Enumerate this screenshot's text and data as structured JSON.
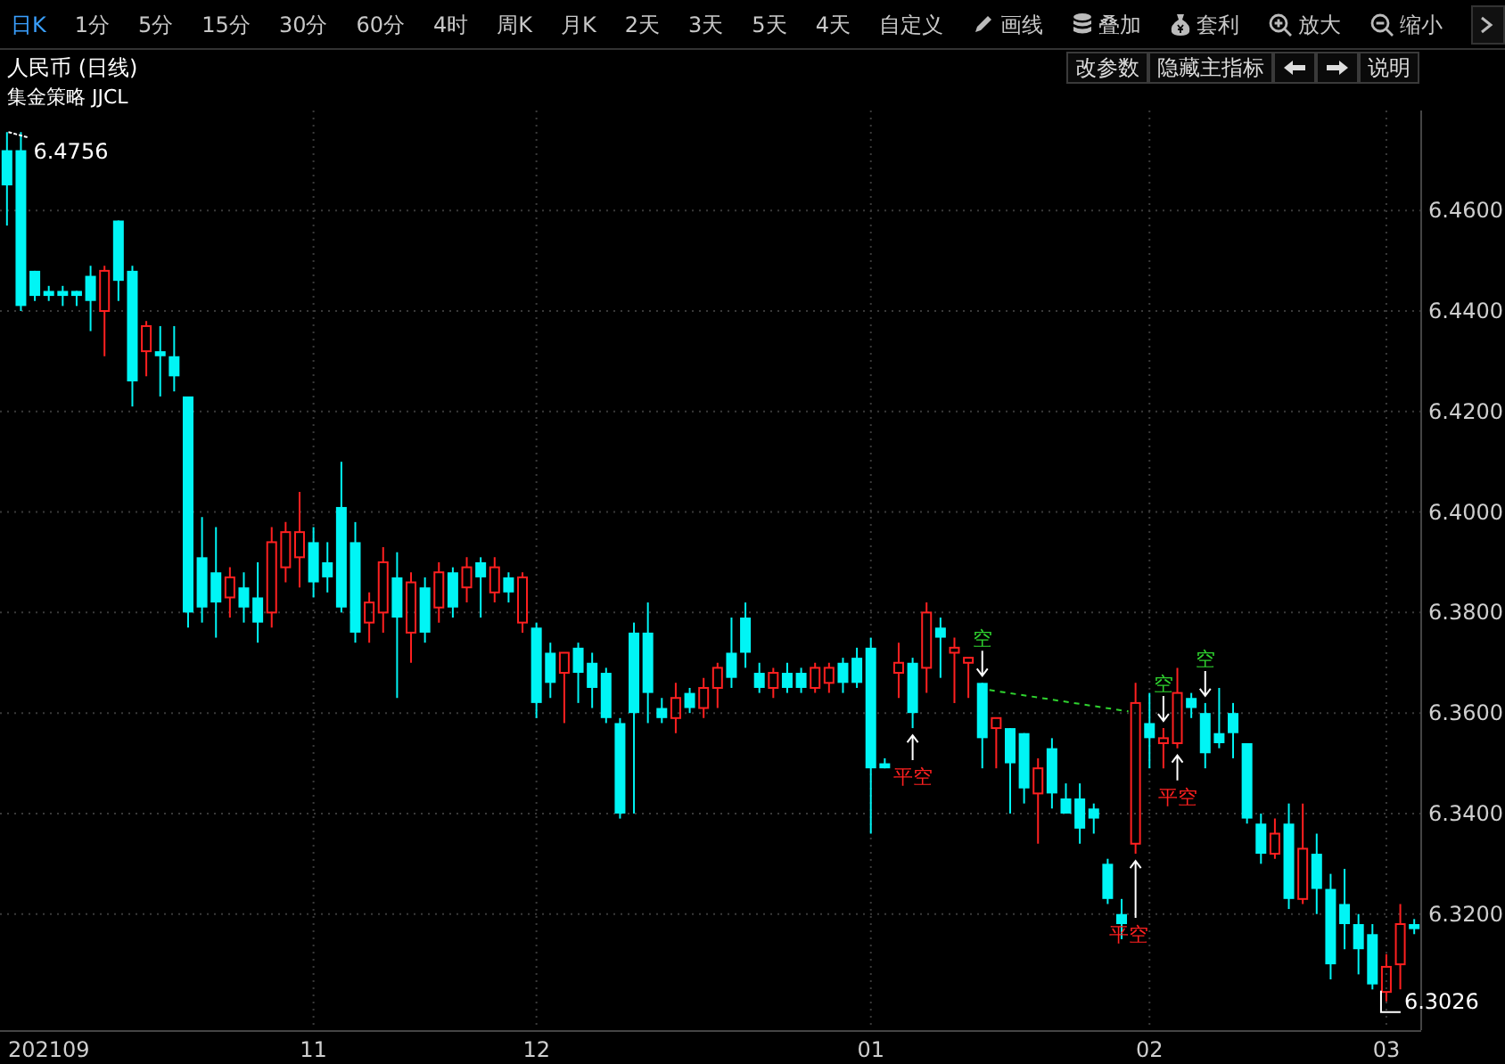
{
  "toolbar": {
    "items": [
      {
        "label": "日K",
        "kind": "period",
        "selected": true
      },
      {
        "label": "1分",
        "kind": "period",
        "selected": false
      },
      {
        "label": "5分",
        "kind": "period",
        "selected": false
      },
      {
        "label": "15分",
        "kind": "period",
        "selected": false
      },
      {
        "label": "30分",
        "kind": "period",
        "selected": false
      },
      {
        "label": "60分",
        "kind": "period",
        "selected": false
      },
      {
        "label": "4时",
        "kind": "period",
        "selected": false
      },
      {
        "label": "周K",
        "kind": "period",
        "selected": false
      },
      {
        "label": "月K",
        "kind": "period",
        "selected": false
      },
      {
        "label": "2天",
        "kind": "period",
        "selected": false
      },
      {
        "label": "3天",
        "kind": "period",
        "selected": false
      },
      {
        "label": "5天",
        "kind": "period",
        "selected": false
      },
      {
        "label": "4天",
        "kind": "period",
        "selected": false
      },
      {
        "label": "自定义",
        "kind": "period",
        "selected": false
      },
      {
        "label": "画线",
        "kind": "tool"
      },
      {
        "label": "叠加",
        "kind": "tool"
      },
      {
        "label": "套利",
        "kind": "tool"
      },
      {
        "label": "放大",
        "kind": "tool"
      },
      {
        "label": "缩小",
        "kind": "tool"
      }
    ]
  },
  "chart_title": "人民币 (日线)",
  "chart_buttons": [
    {
      "label": "改参数",
      "kind": "text"
    },
    {
      "label": "隐藏主指标",
      "kind": "text"
    },
    {
      "kind": "prev"
    },
    {
      "kind": "next"
    },
    {
      "label": "说明",
      "kind": "text"
    }
  ],
  "indicator_label": "集金策略 JJCL",
  "chart": {
    "chart_data": {
      "type": "candlestick",
      "grid": true,
      "ylim": [
        6.2969,
        6.4799
      ],
      "yticks": [
        {
          "value": 6.46,
          "label": "6.4600"
        },
        {
          "value": 6.44,
          "label": "6.4400"
        },
        {
          "value": 6.42,
          "label": "6.4200"
        },
        {
          "value": 6.4,
          "label": "6.4000"
        },
        {
          "value": 6.38,
          "label": "6.3800"
        },
        {
          "value": 6.36,
          "label": "6.3600"
        },
        {
          "value": 6.34,
          "label": "6.3400"
        },
        {
          "value": 6.32,
          "label": "6.3200"
        }
      ],
      "categories": [
        null,
        null,
        null,
        "202109",
        null,
        null,
        null,
        null,
        null,
        null,
        null,
        null,
        null,
        null,
        null,
        null,
        null,
        null,
        null,
        null,
        null,
        null,
        "11",
        null,
        null,
        null,
        null,
        null,
        null,
        null,
        null,
        null,
        null,
        null,
        null,
        null,
        null,
        null,
        "12",
        null,
        null,
        null,
        null,
        null,
        null,
        null,
        null,
        null,
        null,
        null,
        null,
        null,
        null,
        null,
        null,
        null,
        null,
        null,
        null,
        null,
        null,
        null,
        "01",
        null,
        null,
        null,
        null,
        null,
        null,
        null,
        null,
        null,
        null,
        null,
        null,
        null,
        null,
        null,
        null,
        null,
        null,
        null,
        "02",
        null,
        null,
        null,
        null,
        null,
        null,
        null,
        null,
        null,
        null,
        null,
        null,
        null,
        null,
        null,
        null,
        "03",
        null,
        null
      ],
      "ohlc": [
        [
          6.472,
          6.4756,
          6.457,
          6.465
        ],
        [
          6.472,
          6.4756,
          6.44,
          6.441
        ],
        [
          6.448,
          6.448,
          6.442,
          6.443
        ],
        [
          6.444,
          6.445,
          6.442,
          6.443
        ],
        [
          6.444,
          6.445,
          6.441,
          6.443
        ],
        [
          6.444,
          6.444,
          6.441,
          6.443
        ],
        [
          6.447,
          6.449,
          6.436,
          6.442
        ],
        [
          6.44,
          6.449,
          6.431,
          6.448
        ],
        [
          6.458,
          6.458,
          6.442,
          6.446
        ],
        [
          6.448,
          6.449,
          6.421,
          6.426
        ],
        [
          6.432,
          6.438,
          6.427,
          6.437
        ],
        [
          6.432,
          6.437,
          6.423,
          6.431
        ],
        [
          6.431,
          6.437,
          6.424,
          6.427
        ],
        [
          6.423,
          6.423,
          6.377,
          6.38
        ],
        [
          6.391,
          6.399,
          6.378,
          6.381
        ],
        [
          6.388,
          6.397,
          6.375,
          6.382
        ],
        [
          6.383,
          6.389,
          6.379,
          6.387
        ],
        [
          6.385,
          6.388,
          6.378,
          6.381
        ],
        [
          6.383,
          6.39,
          6.374,
          6.378
        ],
        [
          6.38,
          6.397,
          6.377,
          6.394
        ],
        [
          6.389,
          6.398,
          6.386,
          6.396
        ],
        [
          6.391,
          6.404,
          6.385,
          6.396
        ],
        [
          6.394,
          6.397,
          6.383,
          6.386
        ],
        [
          6.39,
          6.394,
          6.384,
          6.387
        ],
        [
          6.401,
          6.41,
          6.38,
          6.381
        ],
        [
          6.394,
          6.398,
          6.374,
          6.376
        ],
        [
          6.378,
          6.384,
          6.374,
          6.382
        ],
        [
          6.38,
          6.393,
          6.376,
          6.39
        ],
        [
          6.387,
          6.392,
          6.363,
          6.379
        ],
        [
          6.376,
          6.388,
          6.37,
          6.386
        ],
        [
          6.385,
          6.387,
          6.374,
          6.376
        ],
        [
          6.381,
          6.39,
          6.378,
          6.388
        ],
        [
          6.388,
          6.389,
          6.379,
          6.381
        ],
        [
          6.385,
          6.391,
          6.382,
          6.389
        ],
        [
          6.39,
          6.391,
          6.379,
          6.387
        ],
        [
          6.384,
          6.391,
          6.382,
          6.389
        ],
        [
          6.387,
          6.388,
          6.382,
          6.384
        ],
        [
          6.378,
          6.388,
          6.376,
          6.387
        ],
        [
          6.377,
          6.378,
          6.359,
          6.362
        ],
        [
          6.372,
          6.374,
          6.363,
          6.366
        ],
        [
          6.368,
          6.372,
          6.358,
          6.372
        ],
        [
          6.373,
          6.374,
          6.362,
          6.368
        ],
        [
          6.37,
          6.372,
          6.361,
          6.365
        ],
        [
          6.368,
          6.369,
          6.358,
          6.359
        ],
        [
          6.358,
          6.359,
          6.339,
          6.34
        ],
        [
          6.376,
          6.378,
          6.34,
          6.36
        ],
        [
          6.376,
          6.382,
          6.358,
          6.364
        ],
        [
          6.361,
          6.363,
          6.358,
          6.359
        ],
        [
          6.359,
          6.366,
          6.356,
          6.363
        ],
        [
          6.364,
          6.365,
          6.36,
          6.361
        ],
        [
          6.361,
          6.367,
          6.359,
          6.365
        ],
        [
          6.365,
          6.37,
          6.361,
          6.369
        ],
        [
          6.372,
          6.379,
          6.365,
          6.367
        ],
        [
          6.379,
          6.382,
          6.369,
          6.372
        ],
        [
          6.368,
          6.37,
          6.364,
          6.365
        ],
        [
          6.365,
          6.369,
          6.363,
          6.368
        ],
        [
          6.368,
          6.37,
          6.364,
          6.365
        ],
        [
          6.368,
          6.369,
          6.364,
          6.365
        ],
        [
          6.365,
          6.37,
          6.364,
          6.369
        ],
        [
          6.366,
          6.37,
          6.364,
          6.369
        ],
        [
          6.37,
          6.371,
          6.364,
          6.366
        ],
        [
          6.371,
          6.373,
          6.365,
          6.366
        ],
        [
          6.373,
          6.375,
          6.336,
          6.349
        ],
        [
          6.35,
          6.351,
          6.349,
          6.349
        ],
        [
          6.368,
          6.374,
          6.363,
          6.37
        ],
        [
          6.37,
          6.371,
          6.357,
          6.36
        ],
        [
          6.369,
          6.382,
          6.364,
          6.38
        ],
        [
          6.377,
          6.379,
          6.367,
          6.375
        ],
        [
          6.372,
          6.375,
          6.362,
          6.373
        ],
        [
          6.37,
          6.371,
          6.363,
          6.371
        ],
        [
          6.366,
          6.366,
          6.349,
          6.355
        ],
        [
          6.357,
          6.359,
          6.349,
          6.359
        ],
        [
          6.357,
          6.357,
          6.34,
          6.35
        ],
        [
          6.356,
          6.356,
          6.342,
          6.345
        ],
        [
          6.344,
          6.351,
          6.334,
          6.349
        ],
        [
          6.353,
          6.355,
          6.341,
          6.344
        ],
        [
          6.343,
          6.346,
          6.34,
          6.34
        ],
        [
          6.343,
          6.346,
          6.334,
          6.337
        ],
        [
          6.341,
          6.342,
          6.336,
          6.339
        ],
        [
          6.33,
          6.331,
          6.322,
          6.323
        ],
        [
          6.32,
          6.323,
          6.315,
          6.318
        ],
        [
          6.334,
          6.366,
          6.332,
          6.362
        ],
        [
          6.358,
          6.364,
          6.349,
          6.355
        ],
        [
          6.354,
          6.357,
          6.349,
          6.355
        ],
        [
          6.354,
          6.369,
          6.353,
          6.364
        ],
        [
          6.363,
          6.364,
          6.359,
          6.361
        ],
        [
          6.36,
          6.362,
          6.349,
          6.352
        ],
        [
          6.356,
          6.365,
          6.353,
          6.354
        ],
        [
          6.36,
          6.362,
          6.351,
          6.356
        ],
        [
          6.354,
          6.354,
          6.338,
          6.339
        ],
        [
          6.338,
          6.34,
          6.33,
          6.332
        ],
        [
          6.332,
          6.339,
          6.331,
          6.336
        ],
        [
          6.338,
          6.342,
          6.321,
          6.323
        ],
        [
          6.323,
          6.342,
          6.322,
          6.333
        ],
        [
          6.332,
          6.336,
          6.32,
          6.325
        ],
        [
          6.325,
          6.328,
          6.307,
          6.31
        ],
        [
          6.322,
          6.329,
          6.313,
          6.318
        ],
        [
          6.318,
          6.32,
          6.308,
          6.313
        ],
        [
          6.316,
          6.318,
          6.305,
          6.306
        ],
        [
          6.3045,
          6.312,
          6.3026,
          6.3095
        ],
        [
          6.31,
          6.322,
          6.305,
          6.318
        ],
        [
          6.318,
          6.319,
          6.316,
          6.317
        ]
      ],
      "annotations": [
        "6.4756",
        "6.3026",
        "空",
        "空",
        "空",
        "平空",
        "平空",
        "平空"
      ]
    }
  }
}
